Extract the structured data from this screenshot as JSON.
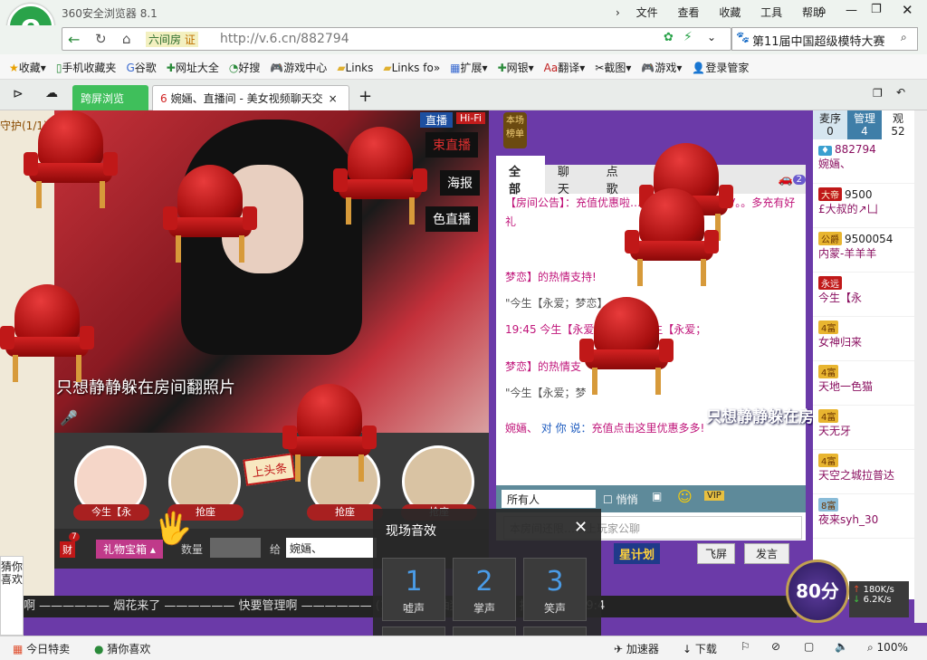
{
  "browser": {
    "title": "360安全浏览器 8.1",
    "menu": [
      "文件",
      "查看",
      "收藏",
      "工具",
      "帮助"
    ],
    "url_prefix": "六间房",
    "cert": "证",
    "url": "http://v.6.cn/882794",
    "search_value": "第11届中国超级模特大赛"
  },
  "favorites": [
    "收藏",
    "手机收藏夹",
    "谷歌",
    "网址大全",
    "好搜",
    "游戏中心",
    "Links",
    "Links fo",
    "扩展",
    "网银",
    "翻译",
    "截图",
    "游戏",
    "登录管家"
  ],
  "tabs": {
    "cross_screen": "跨屏浏览",
    "active": "婉婳、直播间 - 美女视频聊天交"
  },
  "room": {
    "guard": "守护(1/1)",
    "live": "直播",
    "hifi": "Hi-Fi",
    "end_live": "束直播",
    "poster": "海报",
    "color_live": "色直播",
    "caption": "只想静静躲在房间翻照片",
    "rank": "本场榜单",
    "gift_box": "礼物宝箱",
    "qty_label": "数量",
    "give_label": "给",
    "give_to": "婉婳、",
    "seat_name": "今生【永",
    "grab": "抢座",
    "top_label": "上头条",
    "wealth": "财",
    "wealth_count": "7"
  },
  "chat": {
    "tabs": [
      "全部",
      "聊天",
      "点歌"
    ],
    "car_count": "2",
    "notice": "【房间公告】：充值优惠啦……买三个绿卡送黄V。。多充有好礼",
    "lines": [
      "梦恋】的热情支持!",
      "\"今生【永爱；梦恋】",
      "19:45 今生【永爱……感谢 今生【永爱；",
      "梦恋】的热情支",
      "\"今生【永爱；梦"
    ],
    "promo_from": "婉婳、",
    "promo_mid": "对 你 说：",
    "promo": "充值点击这里优惠多多!",
    "overlay": "只想静静躲在房间翻照片",
    "to": "所有人",
    "private": "悄悄",
    "input_placeholder": "本房间还限…以上玩家公聊",
    "fly": "飞屏",
    "send": "发言",
    "vip": "VIP"
  },
  "viewers": {
    "tabs": [
      {
        "label": "麦序",
        "count": "0"
      },
      {
        "label": "管理",
        "count": "4"
      },
      {
        "label": "观",
        "count": "52"
      }
    ],
    "list": [
      {
        "id": "882794",
        "name": "婉婳、"
      },
      {
        "id": "9500",
        "name": "£大叔的↗凵"
      },
      {
        "id": "9500054",
        "name": "内蒙-羊羊羊"
      },
      {
        "id": "",
        "name": "今生【永"
      },
      {
        "id": "",
        "name": "女神归来"
      },
      {
        "id": "",
        "name": "天地一色猫"
      },
      {
        "id": "",
        "name": "天无牙"
      },
      {
        "id": "",
        "name": "天空之城拉普达"
      },
      {
        "id": "",
        "name": "夜来syh_30"
      }
    ]
  },
  "ticker": "管理啊 —————— 烟花来了 —————— 快要管理啊 —————— (19:4 …… 抽奖 抽奖 抽奖 抽奖 抽奖 (19:4",
  "effects": {
    "title": "现场音效",
    "keys": [
      {
        "n": "1",
        "l": "嘘声"
      },
      {
        "n": "2",
        "l": "掌声"
      },
      {
        "n": "3",
        "l": "笑声"
      },
      {
        "n": "4",
        "l": ""
      },
      {
        "n": "5",
        "l": ""
      },
      {
        "n": "6",
        "l": ""
      }
    ]
  },
  "star_plan": "星计划",
  "guess": "猜你喜欢",
  "speed": {
    "score": "80分",
    "up": "180K/s",
    "down": "6.2K/s"
  },
  "status": {
    "today": "今日特卖",
    "guess": "猜你喜欢",
    "accel": "加速器",
    "download": "下载",
    "zoom": "100%"
  }
}
